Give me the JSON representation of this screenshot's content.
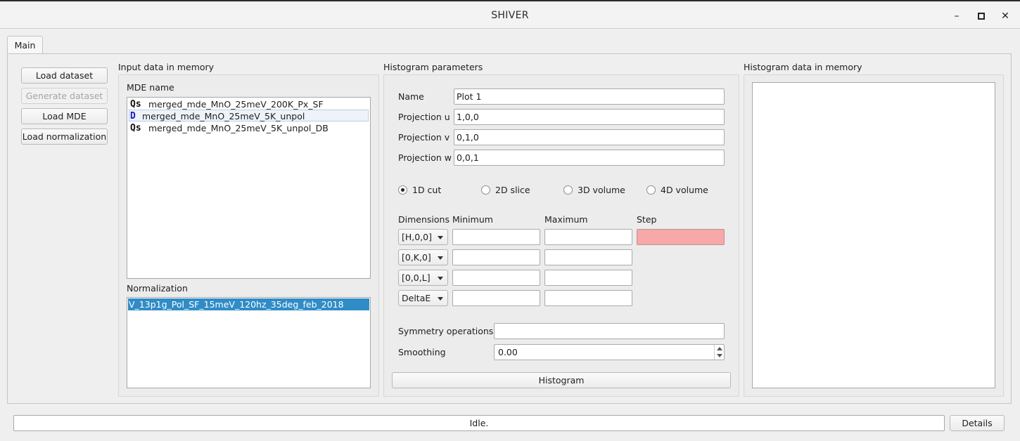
{
  "window": {
    "title": "SHIVER",
    "minimize_glyph": "–",
    "maximize_glyph": "■",
    "close_glyph": "✕"
  },
  "tabs": [
    {
      "label": "Main",
      "active": true
    }
  ],
  "actions": {
    "load_dataset": "Load dataset",
    "generate_dataset": "Generate dataset",
    "load_mde": "Load MDE",
    "load_normalization": "Load normalization"
  },
  "input_data": {
    "title": "Input data in memory",
    "mde_label": "MDE name",
    "mde_items": [
      {
        "icon": "Qs",
        "name": "merged_mde_MnO_25meV_200K_Px_SF"
      },
      {
        "icon": "D",
        "name": "merged_mde_MnO_25meV_5K_unpol"
      },
      {
        "icon": "Qs",
        "name": "merged_mde_MnO_25meV_5K_unpol_DB"
      }
    ],
    "normalization_label": "Normalization",
    "normalization_items": [
      {
        "name": "V_13p1g_Pol_SF_15meV_120hz_35deg_feb_2018",
        "selected": true
      }
    ]
  },
  "histogram_params": {
    "title": "Histogram parameters",
    "name_label": "Name",
    "name_value": "Plot 1",
    "proj_u_label": "Projection u",
    "proj_u_value": "1,0,0",
    "proj_v_label": "Projection v",
    "proj_v_value": "0,1,0",
    "proj_w_label": "Projection w",
    "proj_w_value": "0,0,1",
    "modes": [
      {
        "label": "1D cut",
        "checked": true
      },
      {
        "label": "2D slice",
        "checked": false
      },
      {
        "label": "3D volume",
        "checked": false
      },
      {
        "label": "4D volume",
        "checked": false
      }
    ],
    "col_dimensions": "Dimensions",
    "col_minimum": "Minimum",
    "col_maximum": "Maximum",
    "col_step": "Step",
    "dimensions": [
      {
        "value": "[H,0,0]",
        "min": "",
        "max": "",
        "step": ""
      },
      {
        "value": "[0,K,0]",
        "min": "",
        "max": ""
      },
      {
        "value": "[0,0,L]",
        "min": "",
        "max": ""
      },
      {
        "value": "DeltaE",
        "min": "",
        "max": ""
      }
    ],
    "symmetry_label": "Symmetry operations",
    "symmetry_value": "",
    "smoothing_label": "Smoothing",
    "smoothing_value": "0.00",
    "histogram_button": "Histogram"
  },
  "histogram_data": {
    "title": "Histogram data in memory"
  },
  "status": {
    "text": "Idle.",
    "details_button": "Details"
  },
  "colors": {
    "selection": "#308cc6",
    "error_field": "#f7a8a8"
  }
}
